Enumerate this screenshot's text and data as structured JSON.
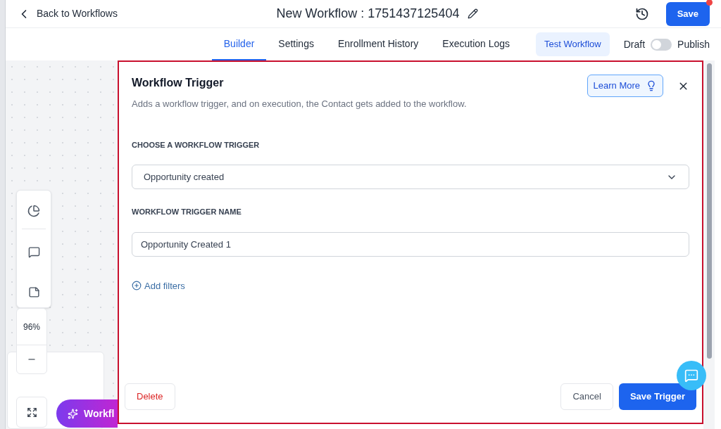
{
  "header": {
    "back_link": "Back to Workflows",
    "title": "New Workflow : 1751437125404",
    "save_button": "Save",
    "save_notification": true
  },
  "tabs": [
    {
      "label": "Builder",
      "selected": true
    },
    {
      "label": "Settings",
      "selected": false
    },
    {
      "label": "Enrollment History",
      "selected": false
    },
    {
      "label": "Execution Logs",
      "selected": false
    }
  ],
  "test_button": "Test Workflow",
  "publish_toggle": {
    "off_label": "Draft",
    "on_label": "Publish",
    "on": false
  },
  "canvas": {
    "zoom": "96%",
    "ai_button": "Workfl"
  },
  "panel": {
    "title": "Workflow Trigger",
    "learn_more": "Learn More",
    "description": "Adds a workflow trigger, and on execution, the Contact gets added to the workflow.",
    "trigger_label": "CHOOSE A WORKFLOW TRIGGER",
    "trigger_value": "Opportunity created",
    "name_label": "WORKFLOW TRIGGER NAME",
    "name_value": "Opportunity Created 1",
    "add_filters": "Add filters",
    "delete_button": "Delete",
    "cancel_button": "Cancel",
    "save_button": "Save Trigger"
  }
}
